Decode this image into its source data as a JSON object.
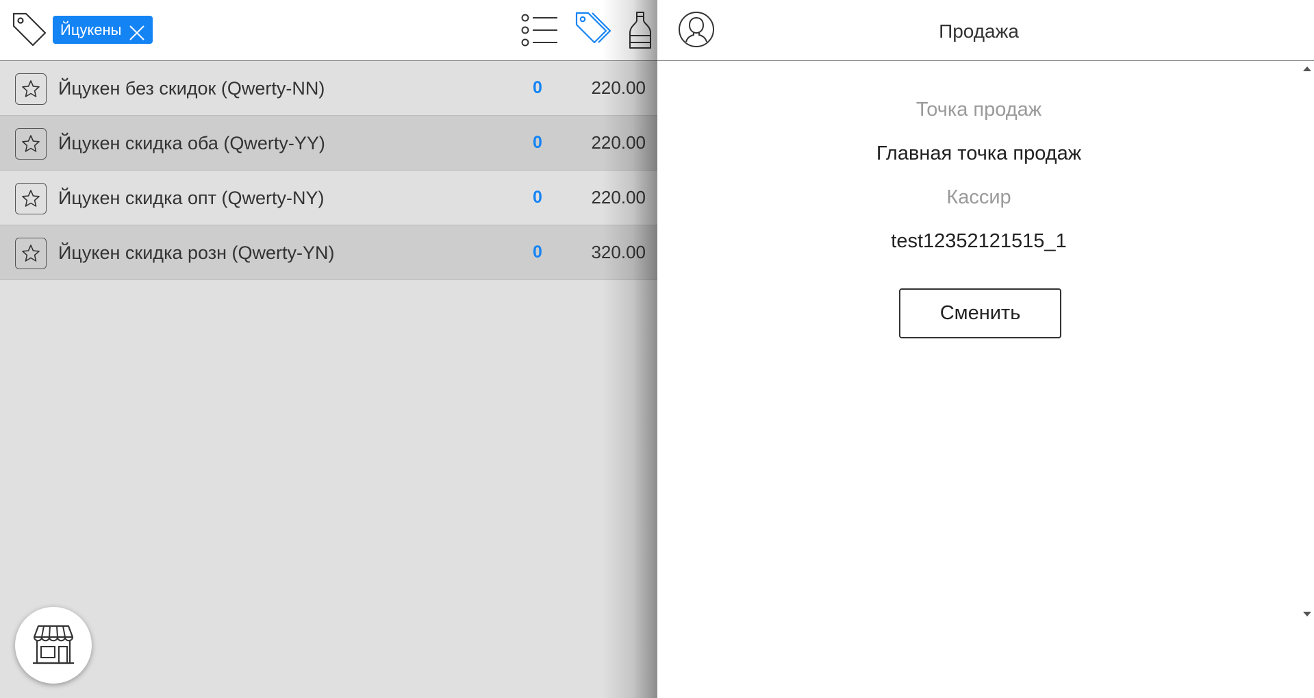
{
  "colors": {
    "accent": "#1484f5",
    "row_even": "#e0e0e0",
    "row_odd": "#cdcdcd",
    "label_gray": "#9a9a9a"
  },
  "left_header": {
    "icons": [
      "tag-icon",
      "list-icon",
      "tags-icon",
      "bottle-icon"
    ],
    "filter_chip": {
      "label": "Йцукены",
      "close_icon": "close-icon"
    }
  },
  "products": [
    {
      "name": "Йцукен без скидок (Qwerty-NN)",
      "qty": "0",
      "price": "220.00"
    },
    {
      "name": "Йцукен скидка оба (Qwerty-YY)",
      "qty": "0",
      "price": "220.00"
    },
    {
      "name": "Йцукен скидка опт (Qwerty-NY)",
      "qty": "0",
      "price": "220.00"
    },
    {
      "name": "Йцукен скидка розн (Qwerty-YN)",
      "qty": "0",
      "price": "320.00"
    }
  ],
  "fab": {
    "icon": "store-icon"
  },
  "right_header": {
    "title": "Продажа",
    "icon": "user-icon"
  },
  "sale_info": {
    "point_label": "Точка продаж",
    "point_value": "Главная точка продаж",
    "cashier_label": "Кассир",
    "cashier_value": "test12352121515_1",
    "change_button": "Сменить"
  }
}
